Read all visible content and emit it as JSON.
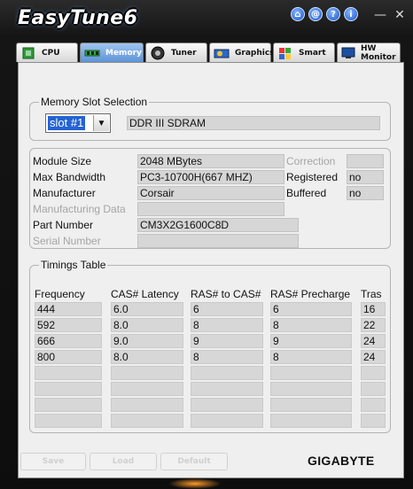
{
  "app": {
    "title": "EasyTune6",
    "title_icons": [
      {
        "name": "home-icon",
        "glyph": "⌂"
      },
      {
        "name": "web-icon",
        "glyph": "@"
      },
      {
        "name": "help-icon",
        "glyph": "?"
      },
      {
        "name": "info-icon",
        "glyph": "i"
      }
    ],
    "minimize_glyph": "—",
    "close_glyph": "✕",
    "accent_color": "#5d93d6"
  },
  "tabs": [
    {
      "label": "CPU",
      "icon": "cpu-chip-icon",
      "active": false
    },
    {
      "label": "Memory",
      "icon": "memory-module-icon",
      "active": true
    },
    {
      "label": "Tuner",
      "icon": "tuner-icon",
      "active": false
    },
    {
      "label": "Graphics",
      "icon": "graphics-card-icon",
      "active": false
    },
    {
      "label": "Smart",
      "icon": "smart-cube-icon",
      "active": false
    },
    {
      "label": "HW Monitor",
      "icon": "hw-monitor-icon",
      "active": false
    }
  ],
  "slot_selection": {
    "title": "Memory Slot Selection",
    "selected": "slot #1",
    "memory_type": "DDR III SDRAM"
  },
  "module_info": {
    "module_size_label": "Module Size",
    "module_size": "2048 MBytes",
    "max_bandwidth_label": "Max Bandwidth",
    "max_bandwidth": "PC3-10700H(667 MHZ)",
    "manufacturer_label": "Manufacturer",
    "manufacturer": "Corsair",
    "manufacturing_data_label": "Manufacturing Data",
    "manufacturing_data": "",
    "part_number_label": "Part Number",
    "part_number": "CM3X2G1600C8D",
    "serial_number_label": "Serial Number",
    "serial_number": "",
    "correction_label": "Correction",
    "correction": "",
    "registered_label": "Registered",
    "registered": "no",
    "buffered_label": "Buffered",
    "buffered": "no"
  },
  "timings": {
    "title": "Timings Table",
    "headers": [
      "Frequency",
      "CAS# Latency",
      "RAS# to CAS#",
      "RAS# Precharge",
      "Tras"
    ],
    "rows": [
      [
        "444",
        "6.0",
        "6",
        "6",
        "16"
      ],
      [
        "592",
        "8.0",
        "8",
        "8",
        "22"
      ],
      [
        "666",
        "9.0",
        "9",
        "9",
        "24"
      ],
      [
        "800",
        "8.0",
        "8",
        "8",
        "24"
      ],
      [
        "",
        "",
        "",
        "",
        ""
      ],
      [
        "",
        "",
        "",
        "",
        ""
      ],
      [
        "",
        "",
        "",
        "",
        ""
      ],
      [
        "",
        "",
        "",
        "",
        ""
      ]
    ]
  },
  "buttons": {
    "save": "Save",
    "load": "Load",
    "default": "Default"
  },
  "brand": "GIGABYTE"
}
